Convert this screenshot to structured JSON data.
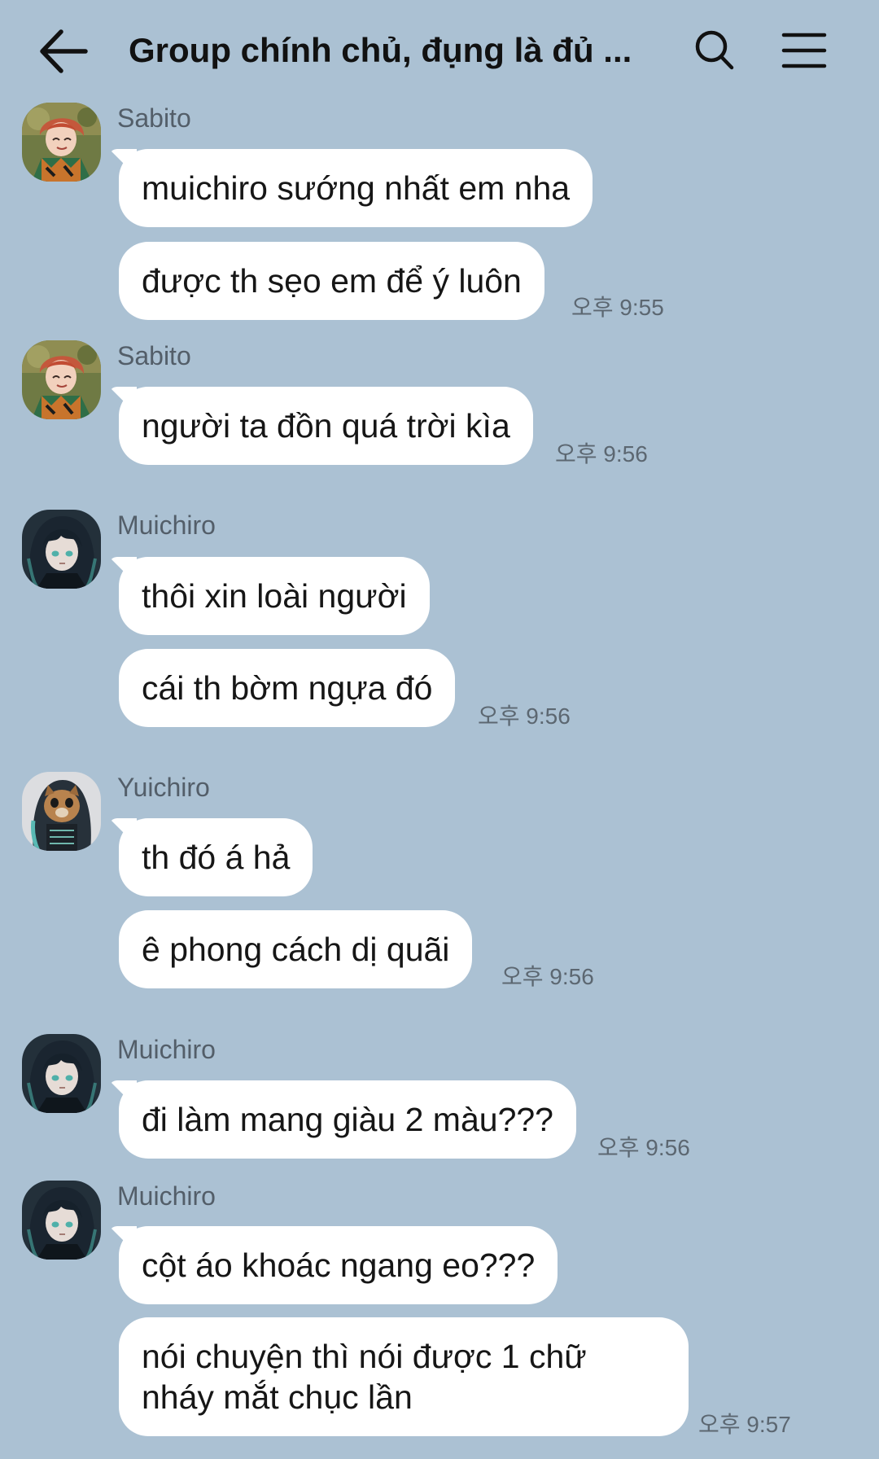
{
  "header": {
    "title": "Group chính chủ, đụng là đủ ...",
    "back_icon": "arrow-left-icon",
    "search_icon": "search-icon",
    "menu_icon": "hamburger-menu-icon"
  },
  "messages": [
    {
      "sender": "Sabito",
      "avatar": "sabito-avatar",
      "bubbles": [
        "muichiro sướng nhất em nha",
        "được th sẹo em để ý luôn"
      ],
      "time": "오후 9:55"
    },
    {
      "sender": "Sabito",
      "avatar": "sabito-avatar",
      "bubbles": [
        "người ta đồn quá trời kìa"
      ],
      "time": "오후 9:56"
    },
    {
      "sender": "Muichiro",
      "avatar": "muichiro-avatar",
      "bubbles": [
        "thôi xin loài người",
        "cái th bờm ngựa đó"
      ],
      "time": "오후 9:56"
    },
    {
      "sender": "Yuichiro",
      "avatar": "yuichiro-avatar",
      "bubbles": [
        "th đó á hả",
        "ê phong cách dị quãi"
      ],
      "time": "오후 9:56"
    },
    {
      "sender": "Muichiro",
      "avatar": "muichiro-avatar",
      "bubbles": [
        "đi làm mang giàu 2 màu???"
      ],
      "time": "오후 9:56"
    },
    {
      "sender": "Muichiro",
      "avatar": "muichiro-avatar",
      "bubbles": [
        "cột áo khoác ngang eo???",
        "nói chuyện thì nói được 1 chữ nháy mắt chục lần"
      ],
      "time": "오후 9:57"
    }
  ],
  "colors": {
    "background": "#abc1d3",
    "bubble": "#ffffff",
    "sender_text": "#535e69",
    "time_text": "#5c6771"
  }
}
